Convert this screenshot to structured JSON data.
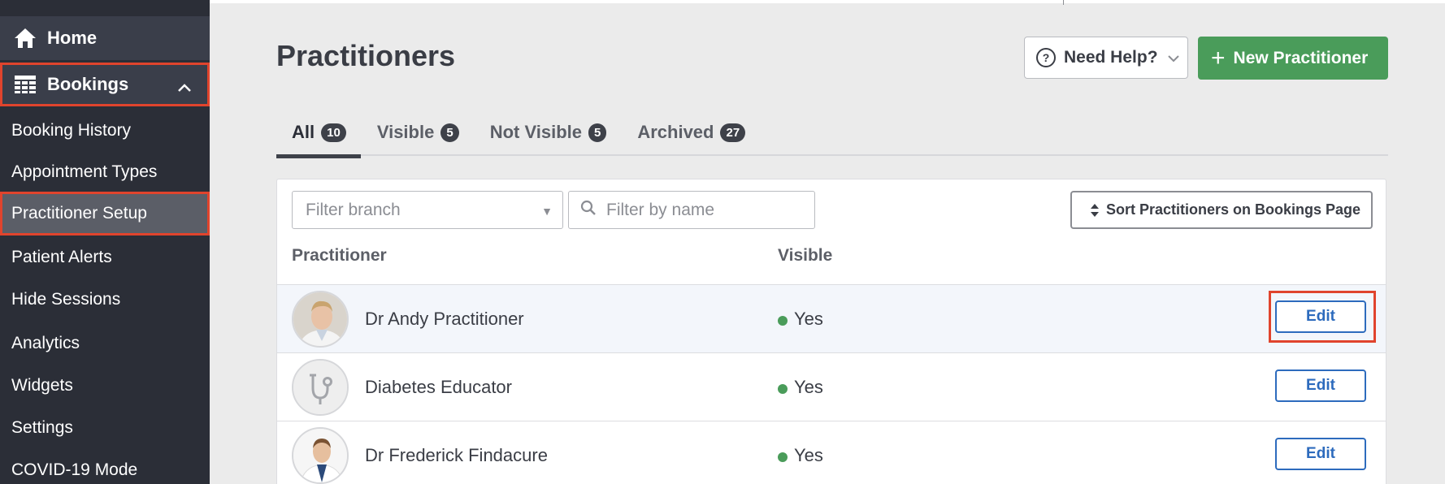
{
  "sidebar": {
    "home_label": "Home",
    "bookings_label": "Bookings",
    "items": [
      {
        "label": "Booking History"
      },
      {
        "label": "Appointment Types"
      },
      {
        "label": "Practitioner Setup"
      },
      {
        "label": "Patient Alerts"
      },
      {
        "label": "Hide Sessions"
      },
      {
        "label": "Analytics"
      },
      {
        "label": "Widgets"
      },
      {
        "label": "Settings"
      },
      {
        "label": "COVID-19 Mode"
      }
    ]
  },
  "header": {
    "title": "Practitioners",
    "help_label": "Need Help?",
    "new_label": "New Practitioner"
  },
  "tabs": [
    {
      "label": "All",
      "count": "10"
    },
    {
      "label": "Visible",
      "count": "5"
    },
    {
      "label": "Not Visible",
      "count": "5"
    },
    {
      "label": "Archived",
      "count": "27"
    }
  ],
  "filters": {
    "branch_placeholder": "Filter branch",
    "name_placeholder": "Filter by name",
    "sort_label": "Sort Practitioners on Bookings Page"
  },
  "table": {
    "headers": {
      "practitioner": "Practitioner",
      "visible": "Visible"
    },
    "rows": [
      {
        "name": "Dr Andy Practitioner",
        "visible": "Yes",
        "action": "Edit"
      },
      {
        "name": "Diabetes Educator",
        "visible": "Yes",
        "action": "Edit"
      },
      {
        "name": "Dr Frederick Findacure",
        "visible": "Yes",
        "action": "Edit"
      }
    ]
  },
  "colors": {
    "sidebar_bg": "#2b2e37",
    "accent_green": "#4a9c5a",
    "link_blue": "#2d6bbd",
    "highlight_red": "#e0442d"
  }
}
